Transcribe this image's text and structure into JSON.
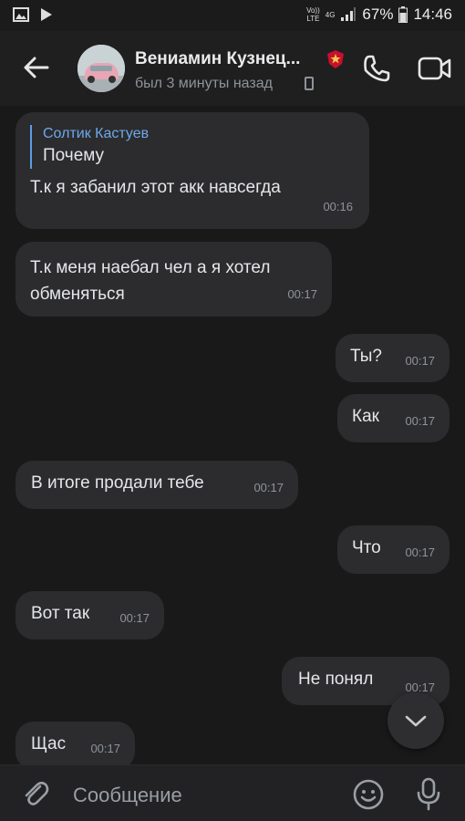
{
  "status_bar": {
    "lte_top": "Vo))",
    "lte_bottom": "LTE",
    "network": "4G",
    "battery": "67%",
    "time": "14:46"
  },
  "header": {
    "contact_name": "Вениамин Кузнец...",
    "last_seen": "был 3 минуты назад"
  },
  "messages": [
    {
      "side": "in",
      "reply_author": "Солтик Кастуев",
      "reply_text": "Почему",
      "text": "Т.к я забанил этот акк навсегда",
      "time": "00:16"
    },
    {
      "side": "in",
      "line1": "Т.к меня наебал чел а я хотел",
      "line2": "обменяться",
      "time": "00:17"
    },
    {
      "side": "out",
      "text": "Ты?",
      "time": "00:17"
    },
    {
      "side": "out",
      "text": "Как",
      "time": "00:17"
    },
    {
      "side": "in",
      "text": "В итоге продали тебе",
      "time": "00:17"
    },
    {
      "side": "out",
      "text": "Что",
      "time": "00:17"
    },
    {
      "side": "in",
      "text": "Вот так",
      "time": "00:17"
    },
    {
      "side": "out",
      "text": "Не понял",
      "time": "00:17"
    },
    {
      "side": "in",
      "text": "Щас",
      "time": "00:17"
    }
  ],
  "composer": {
    "placeholder": "Сообщение"
  },
  "icons": {
    "back": "arrow-left-icon",
    "call": "phone-icon",
    "video": "video-camera-icon",
    "attach": "paperclip-icon",
    "emoji": "smiley-icon",
    "mic": "microphone-icon",
    "scroll": "chevron-down-icon"
  },
  "colors": {
    "background": "#191919",
    "bubble": "#2c2c2e",
    "accent": "#6fa8ec"
  }
}
